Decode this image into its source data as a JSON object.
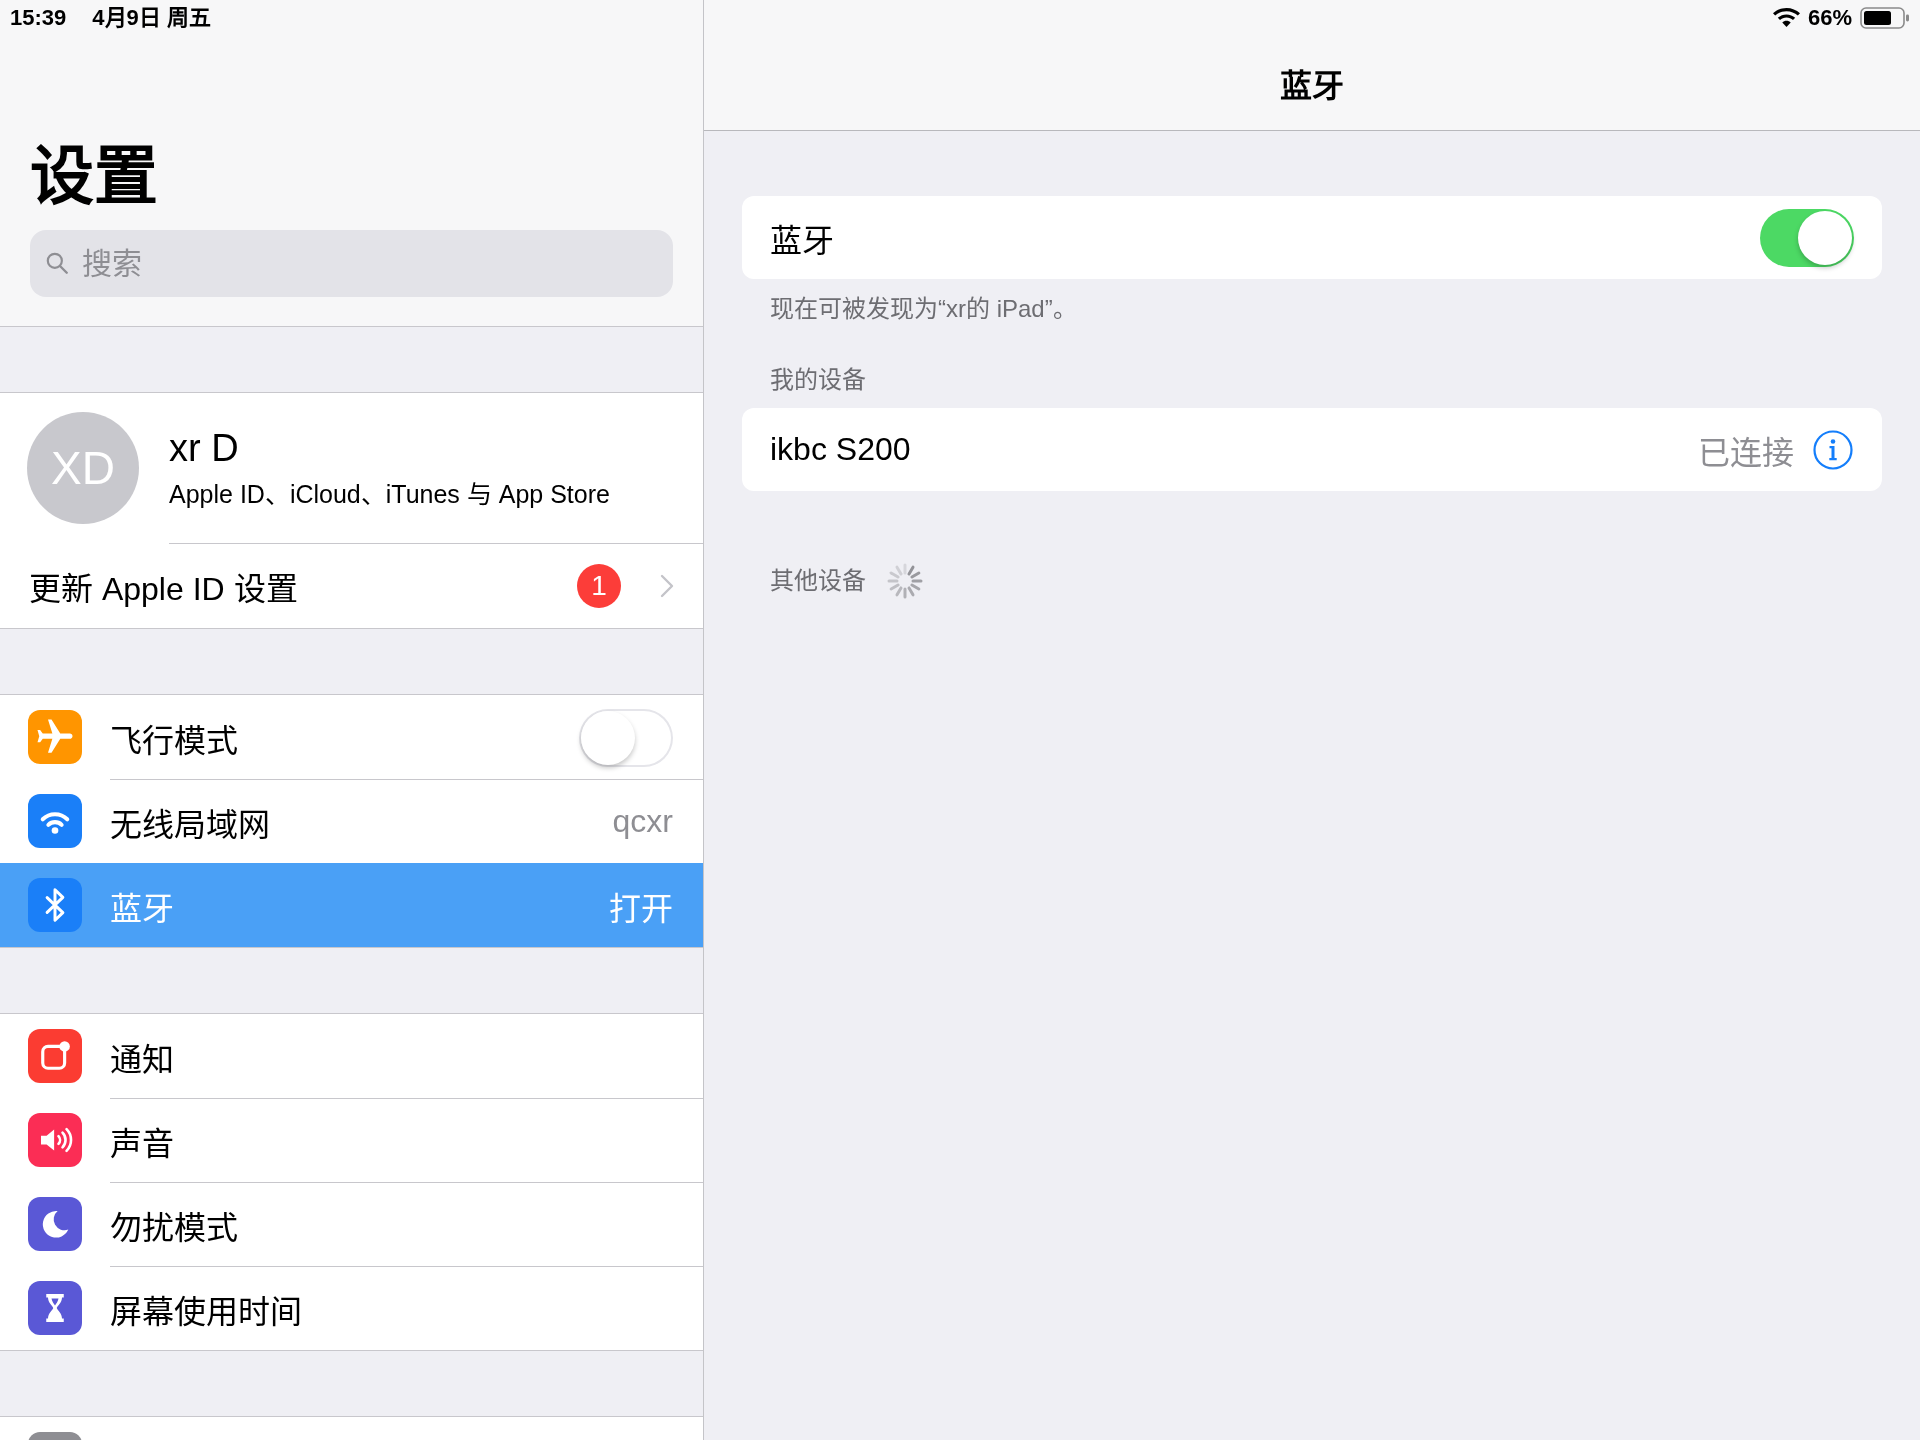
{
  "status_bar": {
    "time": "15:39",
    "date": "4月9日 周五",
    "battery": "66%"
  },
  "sidebar": {
    "title": "设置",
    "search": {
      "placeholder": "搜索"
    },
    "account": {
      "initials": "XD",
      "name": "xr D",
      "subtitle": "Apple ID、iCloud、iTunes 与 App Store"
    },
    "update_notice": {
      "label": "更新 Apple ID 设置",
      "badge": "1"
    },
    "groups": [
      {
        "items": [
          {
            "kind": "toggle",
            "label": "飞行模式",
            "color": "#ff9500",
            "on": false,
            "selected": false
          },
          {
            "kind": "value",
            "label": "无线局域网",
            "color": "#1a7ff8",
            "value": "qcxr",
            "selected": false
          },
          {
            "kind": "value",
            "label": "蓝牙",
            "color": "#1a7ff8",
            "value": "打开",
            "selected": true
          }
        ]
      },
      {
        "items": [
          {
            "kind": "plain",
            "label": "通知",
            "color": "#fb3c32",
            "selected": false
          },
          {
            "kind": "plain",
            "label": "声音",
            "color": "#fb2d55",
            "selected": false
          },
          {
            "kind": "plain",
            "label": "勿扰模式",
            "color": "#5a58d6",
            "selected": false
          },
          {
            "kind": "plain",
            "label": "屏幕使用时间",
            "color": "#5a58d6",
            "selected": false
          }
        ]
      },
      {
        "items": [
          {
            "kind": "plain",
            "color": "#8e8e93",
            "selected": false
          }
        ]
      }
    ]
  },
  "detail": {
    "title": "蓝牙",
    "bluetooth": {
      "label": "蓝牙",
      "on": true
    },
    "note": "现在可被发现为“xr的 iPad”。",
    "my_devices": {
      "header": "我的设备",
      "devices": [
        {
          "name": "ikbc S200",
          "status": "已连接"
        }
      ]
    },
    "other_devices": {
      "header": "其他设备",
      "searching": true
    }
  }
}
